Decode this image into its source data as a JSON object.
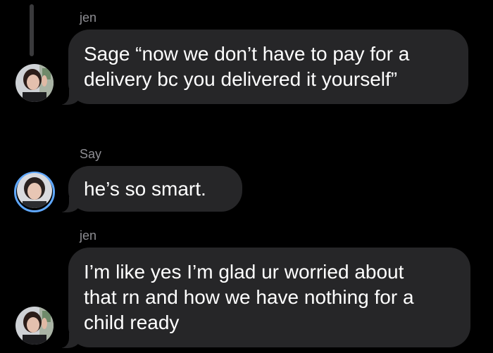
{
  "conversation": {
    "messages": [
      {
        "sender": "jen",
        "text": "Sage “now we don’t have to pay for a\ndelivery bc you delivered it yourself”"
      },
      {
        "sender": "Say",
        "text": "he’s so smart."
      },
      {
        "sender": "jen",
        "text": "I’m like yes I’m glad ur worried about\nthat rn and how we have nothing for a\nchild ready"
      }
    ]
  },
  "colors": {
    "background": "#000000",
    "bubble": "#262628",
    "sender_label": "#8e8e93",
    "story_ring": "#5fa8ff"
  }
}
